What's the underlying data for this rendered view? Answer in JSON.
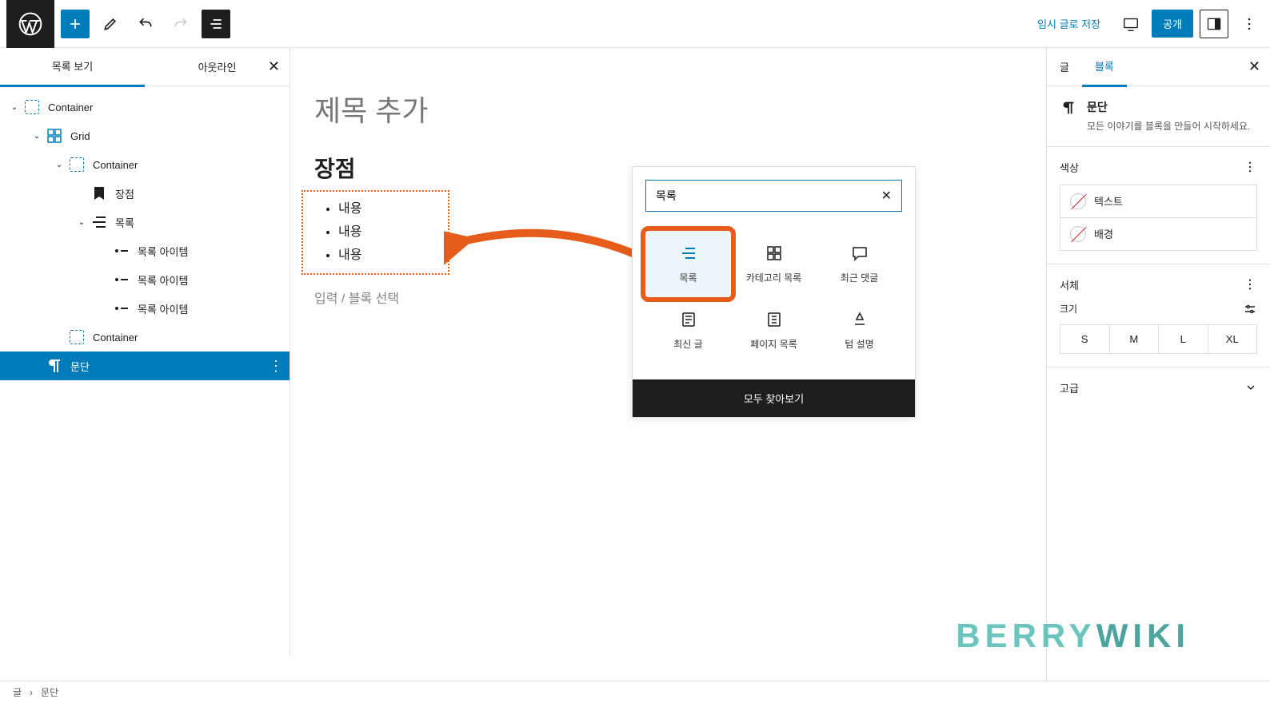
{
  "topbar": {
    "save_draft": "임시 글로 저장",
    "publish": "공개"
  },
  "left_panel": {
    "tabs": {
      "list_view": "목록 보기",
      "outline": "아웃라인"
    },
    "tree": [
      {
        "label": "Container",
        "icon": "dashed",
        "depth": 0,
        "caret": true
      },
      {
        "label": "Grid",
        "icon": "grid",
        "depth": 1,
        "caret": true
      },
      {
        "label": "Container",
        "icon": "dashed",
        "depth": 2,
        "caret": true
      },
      {
        "label": "장점",
        "icon": "bookmark",
        "depth": 3,
        "caret": false
      },
      {
        "label": "목록",
        "icon": "list",
        "depth": 3,
        "caret": true
      },
      {
        "label": "목록 아이템",
        "icon": "dash",
        "depth": 4,
        "caret": false
      },
      {
        "label": "목록 아이템",
        "icon": "dash",
        "depth": 4,
        "caret": false
      },
      {
        "label": "목록 아이템",
        "icon": "dash",
        "depth": 4,
        "caret": false
      },
      {
        "label": "Container",
        "icon": "dashed",
        "depth": 2,
        "caret": false
      },
      {
        "label": "문단",
        "icon": "paragraph",
        "depth": 1,
        "caret": false,
        "selected": true
      }
    ]
  },
  "content": {
    "title_placeholder": "제목 추가",
    "heading": "장점",
    "list_items": [
      "내용",
      "내용",
      "내용"
    ],
    "prompt": "입력 / 블록 선택"
  },
  "inserter": {
    "search_value": "목록",
    "items": [
      {
        "label": "목록",
        "icon": "list",
        "highlighted": true
      },
      {
        "label": "카테고리 목록",
        "icon": "categories"
      },
      {
        "label": "최근 댓글",
        "icon": "comment"
      },
      {
        "label": "최신 글",
        "icon": "post"
      },
      {
        "label": "페이지 목록",
        "icon": "pages"
      },
      {
        "label": "텀 설명",
        "icon": "term"
      }
    ],
    "footer": "모두 찾아보기"
  },
  "right_panel": {
    "tabs": {
      "post": "글",
      "block": "블록"
    },
    "block_name": "문단",
    "block_desc": "모든 이야기를 블록을 만들어 시작하세요.",
    "color": {
      "title": "색상",
      "text": "텍스트",
      "background": "배경"
    },
    "typography": {
      "title": "서체",
      "size_label": "크기",
      "sizes": [
        "S",
        "M",
        "L",
        "XL"
      ]
    },
    "advanced": "고급"
  },
  "breadcrumb": {
    "root": "글",
    "current": "문단"
  },
  "watermark": "BERRYWIKI"
}
